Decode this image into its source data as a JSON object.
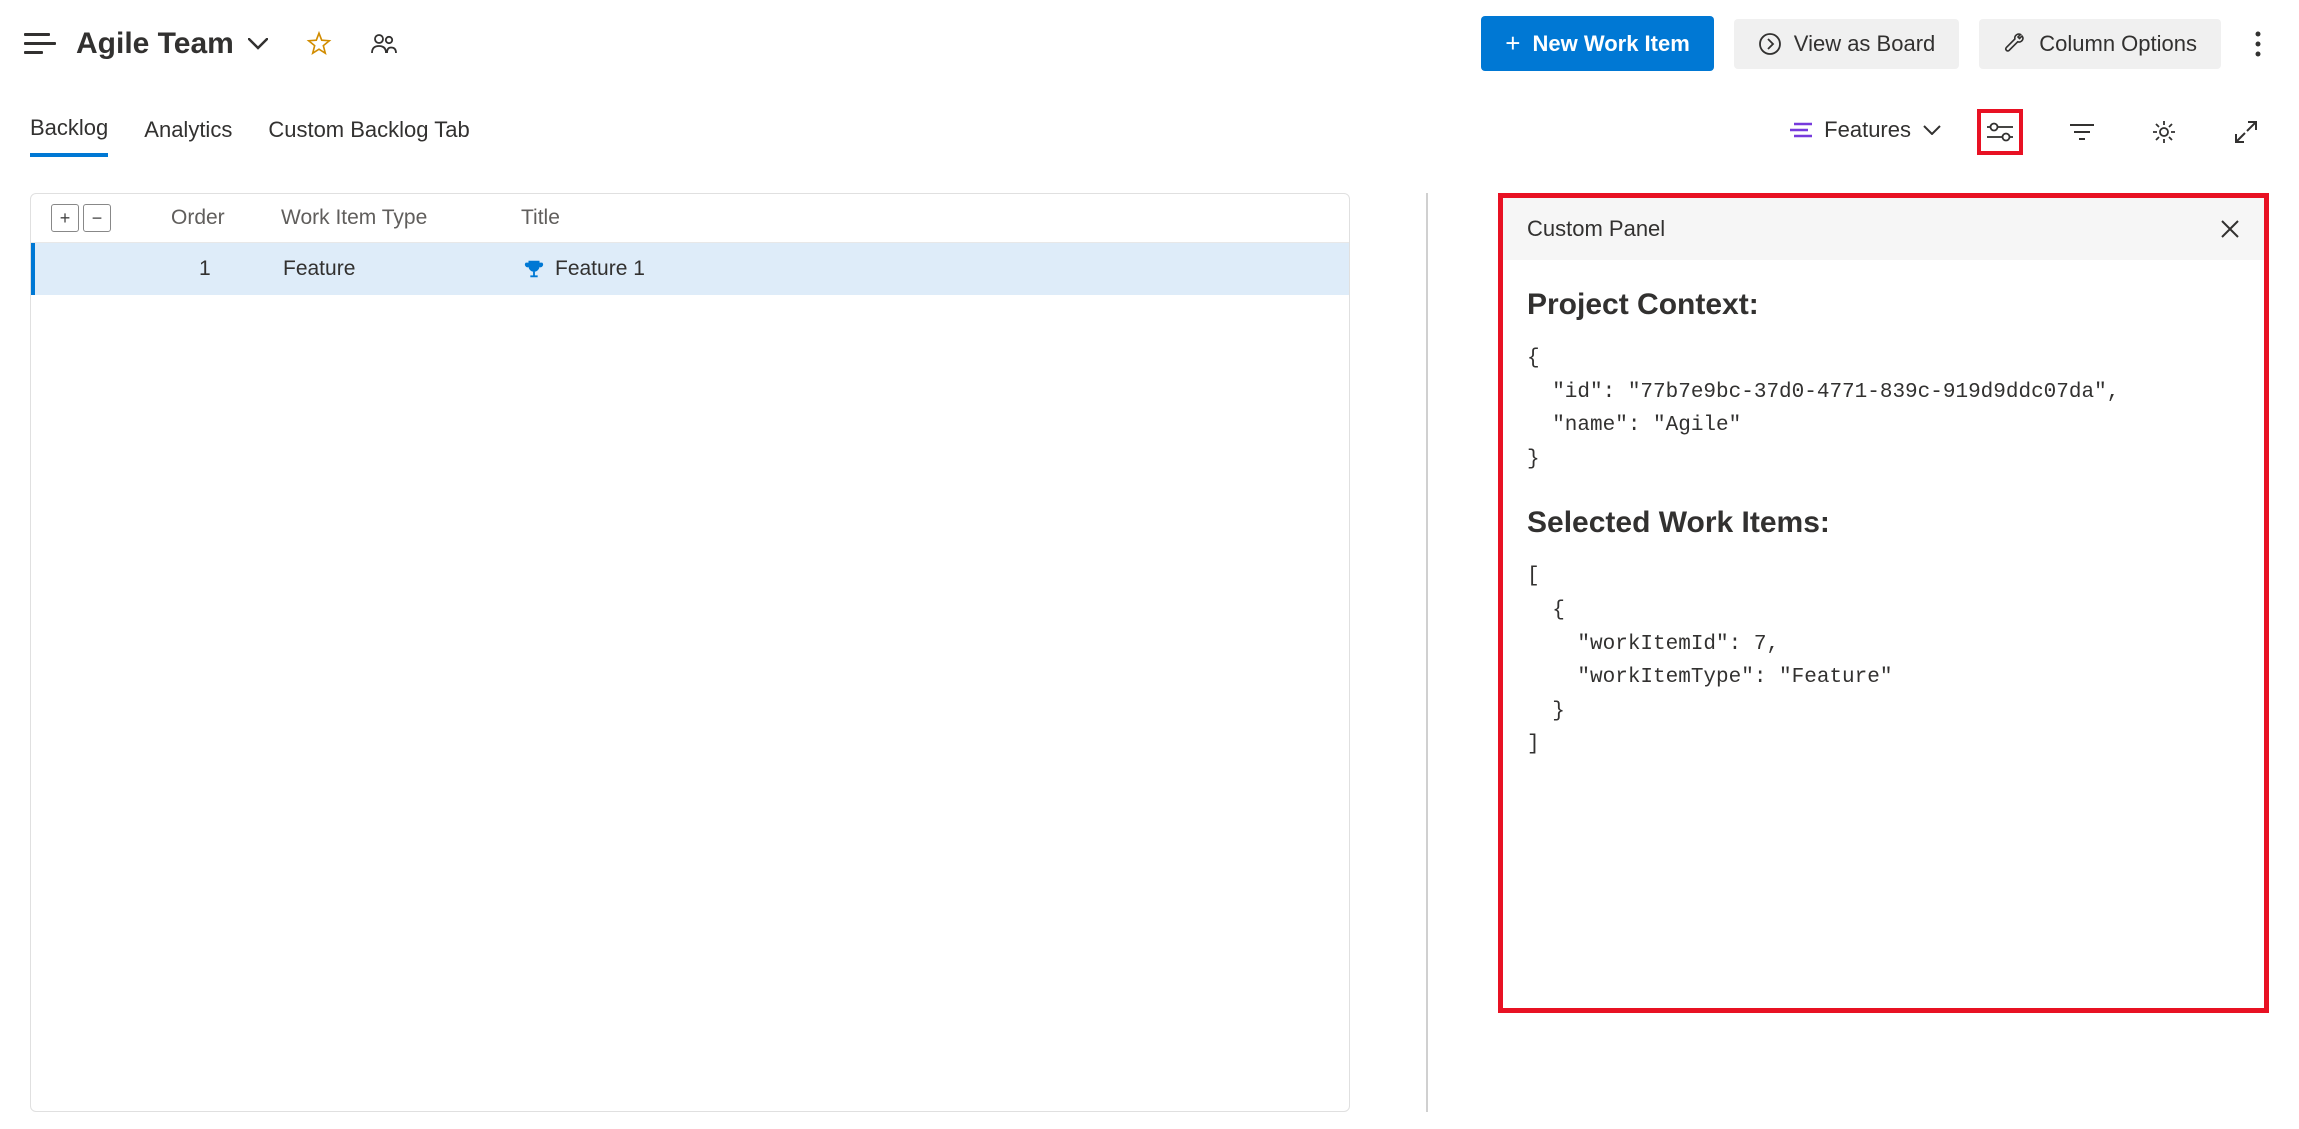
{
  "header": {
    "team_name": "Agile Team",
    "new_work_item_label": "New Work Item",
    "view_as_board_label": "View as Board",
    "column_options_label": "Column Options"
  },
  "tabs": {
    "items": [
      {
        "label": "Backlog",
        "active": true
      },
      {
        "label": "Analytics",
        "active": false
      },
      {
        "label": "Custom Backlog Tab",
        "active": false
      }
    ],
    "backlog_level": "Features"
  },
  "grid": {
    "headers": {
      "order": "Order",
      "type": "Work Item Type",
      "title": "Title"
    },
    "rows": [
      {
        "order": "1",
        "type": "Feature",
        "title": "Feature 1"
      }
    ]
  },
  "panel": {
    "title": "Custom Panel",
    "project_context_heading": "Project Context:",
    "project_context_code": "{\n  \"id\": \"77b7e9bc-37d0-4771-839c-919d9ddc07da\",\n  \"name\": \"Agile\"\n}",
    "selected_items_heading": "Selected Work Items:",
    "selected_items_code": "[\n  {\n    \"workItemId\": 7,\n    \"workItemType\": \"Feature\"\n  }\n]"
  }
}
